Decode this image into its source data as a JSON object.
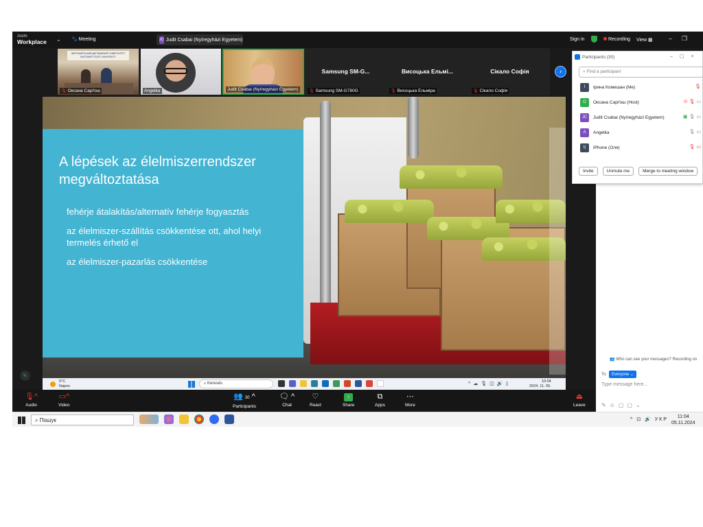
{
  "topbar": {
    "brand_small": "zoom",
    "brand": "Workplace",
    "meeting_label": "Meeting",
    "speaker_badge": "JC",
    "speaker_label": "Judit Csabai (Nyíregyházi Egyetem)",
    "sign_in": "Sign in",
    "recording": "Recording",
    "view": "View"
  },
  "thumbnails": {
    "t1_banner": "ЖИТОМИРСЬКИЙ ДЕРЖАВНИЙ УНІВЕРСИТЕТ ЖИТОМИР STATE UNIVERSITY",
    "t1_label": "Оксана Сарґош",
    "t2_label": "Angelka",
    "t3_label": "Judit Csabai (Nyíregyházi Egyetem)",
    "t4_name": "Samsung SM-G...",
    "t4_label": "Samsung SM-G780G",
    "t5_name": "Висоцька Ельмі...",
    "t5_label": "Висоцька Ельміра",
    "t6_name": "Сікало Софія",
    "t6_label": "Сікало Софія"
  },
  "slide": {
    "title": "A lépések az élelmiszerrendszer megváltoztatása",
    "bullets": [
      "fehérje átalakítás/alternatív fehérje fogyasztás",
      "az élelmiszer-szállítás csökkentése ott, ahol helyi termelés érhető el",
      "az élelmiszer-pazarlás csökkentése"
    ]
  },
  "remote_taskbar": {
    "temp": "5°C",
    "weather": "Napos",
    "search": "Keresés",
    "time": "10:04",
    "date": "2024. 11. 05."
  },
  "controls": {
    "audio": "Audio",
    "video": "Video",
    "participants_count": "30",
    "participants": "Participants",
    "chat": "Chat",
    "react": "React",
    "share": "Share",
    "apps": "Apps",
    "more": "More",
    "leave": "Leave"
  },
  "participants_panel": {
    "title": "Participants (30)",
    "search_placeholder": "Find a participant",
    "rows": [
      {
        "initials": "І",
        "name": "Ірина Комишан (Me)",
        "color": "#3d4a5c"
      },
      {
        "initials": "O",
        "name": "Оксана Сарґош (Host)",
        "color": "#2fae4a"
      },
      {
        "initials": "JC",
        "name": "Judit Csabai (Nyíregyházi Egyetem)",
        "color": "#7b4fc1"
      },
      {
        "initials": "A",
        "name": "Angelka",
        "color": "#7b4fc1"
      },
      {
        "initials": "I(",
        "name": "iPhone (Оля)",
        "color": "#3d4a5c"
      }
    ],
    "invite": "Invite",
    "unmute": "Unmute me",
    "merge": "Merge to meeting window"
  },
  "chat": {
    "who_can_see": "Who can see your messages? Recording on",
    "to": "To:",
    "everyone": "Everyone",
    "placeholder": "Type message here..."
  },
  "local_taskbar": {
    "search": "Пошук",
    "lang": "УКР",
    "time": "11:04",
    "date": "05.11.2024"
  },
  "colors": {
    "slide_box": "#43b4d2",
    "zoom_blue": "#0e72ed",
    "active_green": "#2fae4a",
    "mute_red": "#e53935"
  }
}
